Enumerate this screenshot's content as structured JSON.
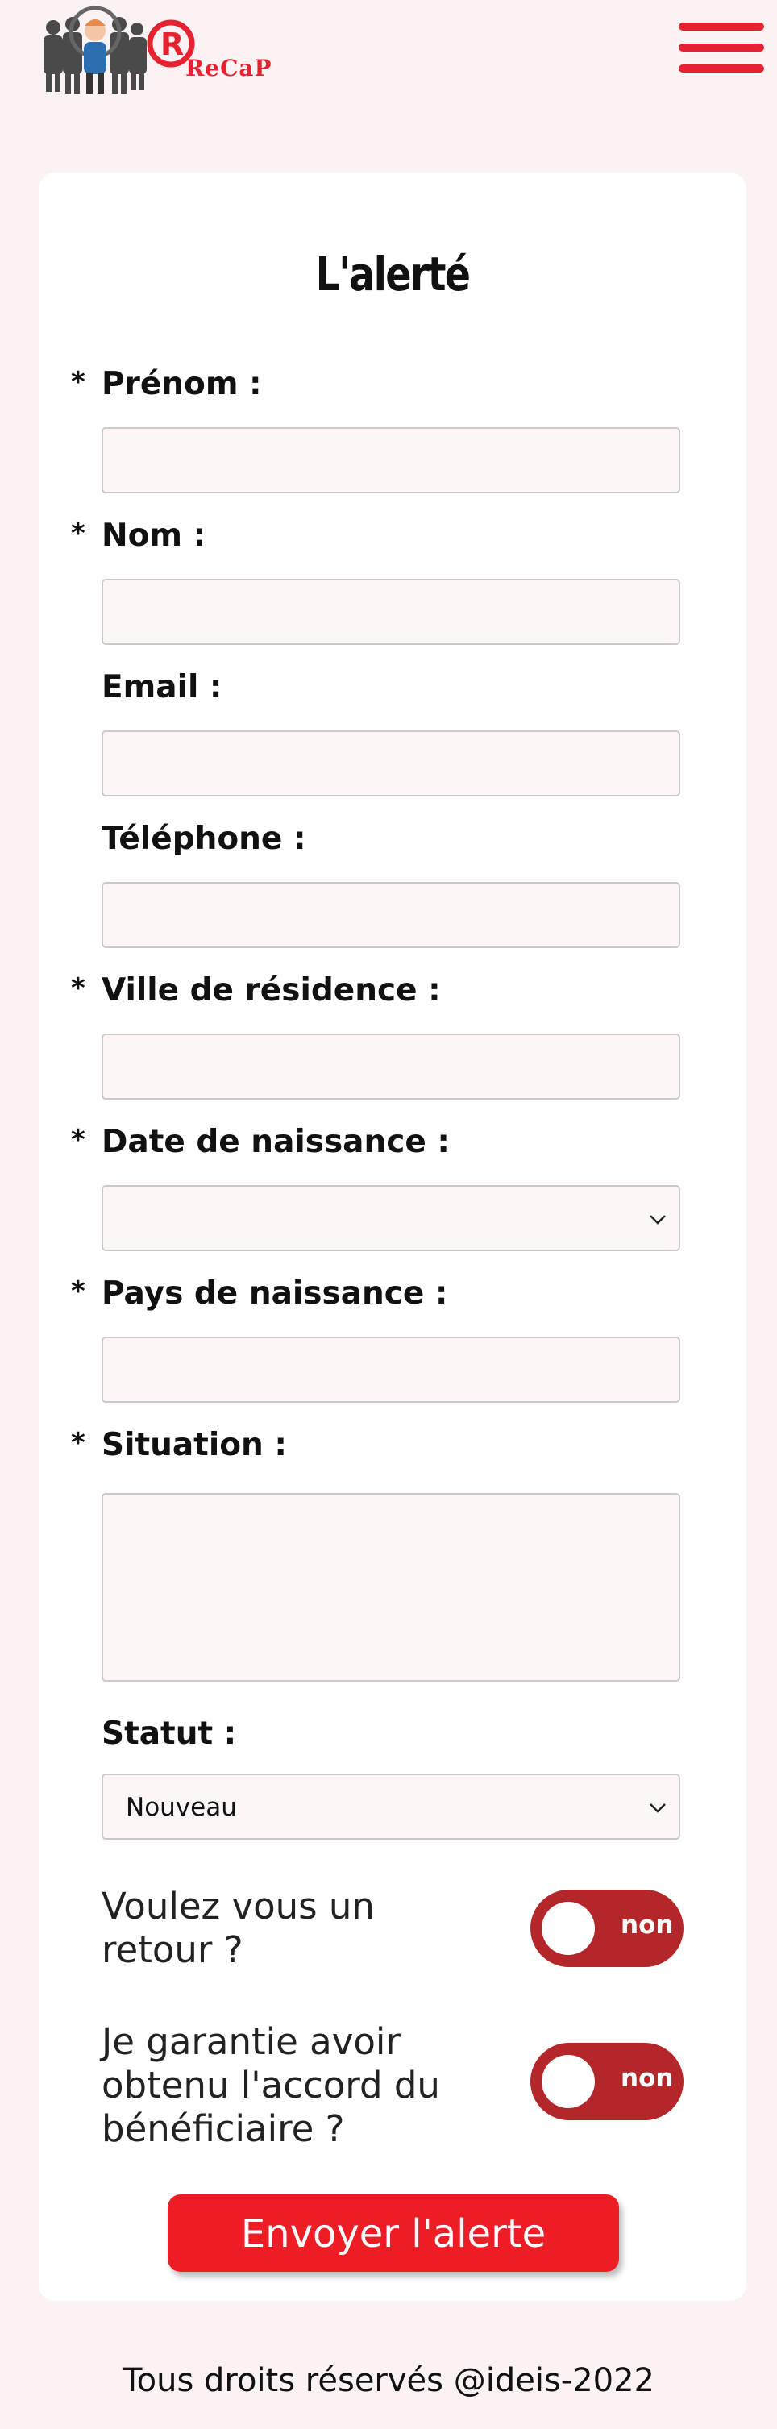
{
  "header": {
    "logo_text": "ReCaP",
    "menu_icon": "hamburger-icon"
  },
  "form": {
    "title": "L'alerté",
    "required_marker": "*",
    "fields": [
      {
        "label": "Prénom :",
        "required": true,
        "type": "text",
        "value": ""
      },
      {
        "label": "Nom :",
        "required": true,
        "type": "text",
        "value": ""
      },
      {
        "label": "Email :",
        "required": false,
        "type": "text",
        "value": ""
      },
      {
        "label": "Téléphone :",
        "required": false,
        "type": "text",
        "value": ""
      },
      {
        "label": "Ville de résidence :",
        "required": true,
        "type": "text",
        "value": ""
      },
      {
        "label": "Date de naissance :",
        "required": true,
        "type": "select",
        "value": ""
      },
      {
        "label": "Pays de naissance :",
        "required": true,
        "type": "text",
        "value": ""
      },
      {
        "label": "Situation :",
        "required": true,
        "type": "textarea",
        "value": ""
      },
      {
        "label": "Statut :",
        "required": false,
        "type": "select",
        "value": "Nouveau"
      }
    ],
    "toggles": [
      {
        "question": "Voulez vous un retour ?",
        "state_label": "non"
      },
      {
        "question": "Je garantie avoir obtenu l'accord du bénéficiaire ?",
        "state_label": "non"
      }
    ],
    "submit_label": "Envoyer l'alerte"
  },
  "footer": {
    "text": "Tous droits réservés @ideis-2022"
  },
  "colors": {
    "accent": "#e52330",
    "button": "#ee1c25",
    "toggle": "#b3272b",
    "page_bg": "#fbf3f3"
  }
}
